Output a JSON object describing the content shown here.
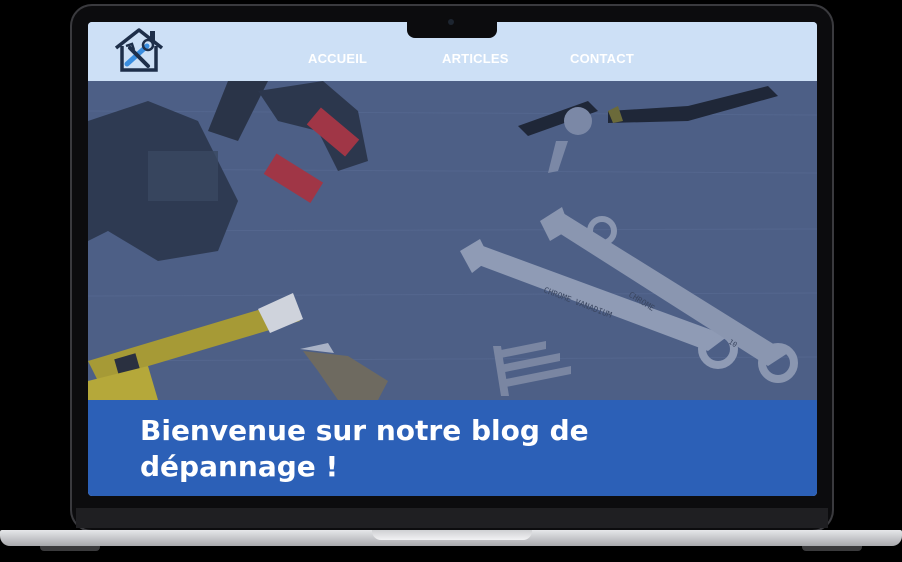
{
  "nav": {
    "items": [
      {
        "label": "ACCUEIL"
      },
      {
        "label": "ARTICLES"
      },
      {
        "label": "CONTACT"
      }
    ]
  },
  "hero": {
    "wrench_text_1": "CHROME VANADIUM",
    "wrench_text_2": "CHROME",
    "wrench_size": "10"
  },
  "banner": {
    "title": "Bienvenue sur notre blog de dépannage !"
  },
  "colors": {
    "navbar": "#cde0f6",
    "banner": "#2c60b7",
    "hero_overlay": "#4d5f86"
  },
  "icons": {
    "logo": "house-wrench-logo-icon"
  }
}
